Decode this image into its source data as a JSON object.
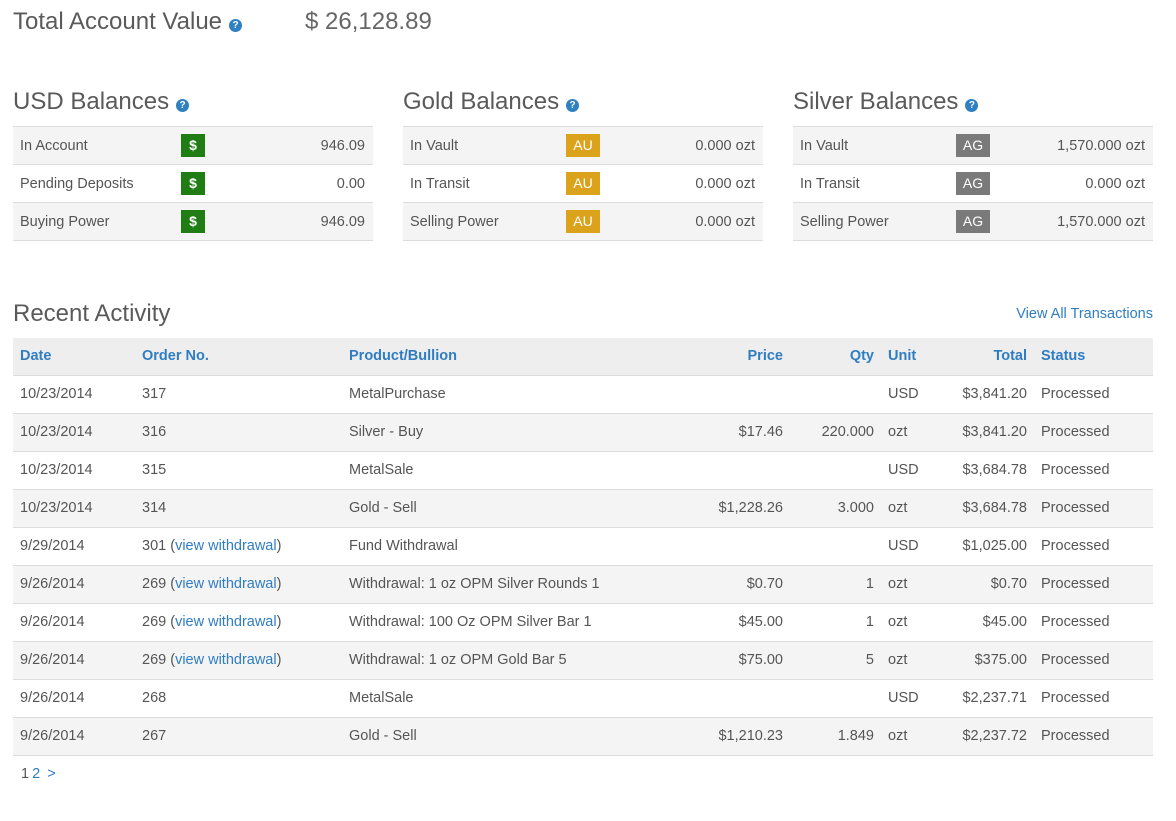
{
  "header": {
    "title": "Total Account Value",
    "value": "$ 26,128.89",
    "help_icon": "?"
  },
  "usd": {
    "title": "USD Balances",
    "rows": [
      {
        "label": "In Account",
        "badge": "$",
        "value": "946.09"
      },
      {
        "label": "Pending Deposits",
        "badge": "$",
        "value": "0.00"
      },
      {
        "label": "Buying Power",
        "badge": "$",
        "value": "946.09"
      }
    ]
  },
  "gold": {
    "title": "Gold Balances",
    "rows": [
      {
        "label": "In Vault",
        "badge": "AU",
        "value": "0.000 ozt"
      },
      {
        "label": "In Transit",
        "badge": "AU",
        "value": "0.000 ozt"
      },
      {
        "label": "Selling Power",
        "badge": "AU",
        "value": "0.000 ozt"
      }
    ]
  },
  "silver": {
    "title": "Silver Balances",
    "rows": [
      {
        "label": "In Vault",
        "badge": "AG",
        "value": "1,570.000 ozt"
      },
      {
        "label": "In Transit",
        "badge": "AG",
        "value": "0.000 ozt"
      },
      {
        "label": "Selling Power",
        "badge": "AG",
        "value": "1,570.000 ozt"
      }
    ]
  },
  "activity": {
    "title": "Recent Activity",
    "view_all": "View All Transactions",
    "columns": [
      "Date",
      "Order No.",
      "Product/Bullion",
      "Price",
      "Qty",
      "Unit",
      "Total",
      "Status"
    ],
    "rows": [
      {
        "date": "10/23/2014",
        "order": "317",
        "link": "",
        "product": "MetalPurchase",
        "price": "",
        "qty": "",
        "unit": "USD",
        "total": "$3,841.20",
        "status": "Processed"
      },
      {
        "date": "10/23/2014",
        "order": "316",
        "link": "",
        "product": "Silver - Buy",
        "price": "$17.46",
        "qty": "220.000",
        "unit": "ozt",
        "total": "$3,841.20",
        "status": "Processed"
      },
      {
        "date": "10/23/2014",
        "order": "315",
        "link": "",
        "product": "MetalSale",
        "price": "",
        "qty": "",
        "unit": "USD",
        "total": "$3,684.78",
        "status": "Processed"
      },
      {
        "date": "10/23/2014",
        "order": "314",
        "link": "",
        "product": "Gold - Sell",
        "price": "$1,228.26",
        "qty": "3.000",
        "unit": "ozt",
        "total": "$3,684.78",
        "status": "Processed"
      },
      {
        "date": "9/29/2014",
        "order": "301",
        "link": "view withdrawal",
        "product": "Fund Withdrawal",
        "price": "",
        "qty": "",
        "unit": "USD",
        "total": "$1,025.00",
        "status": "Processed"
      },
      {
        "date": "9/26/2014",
        "order": "269",
        "link": "view withdrawal",
        "product": "Withdrawal: 1 oz OPM Silver Rounds 1",
        "price": "$0.70",
        "qty": "1",
        "unit": "ozt",
        "total": "$0.70",
        "status": "Processed"
      },
      {
        "date": "9/26/2014",
        "order": "269",
        "link": "view withdrawal",
        "product": "Withdrawal: 100 Oz OPM Silver Bar 1",
        "price": "$45.00",
        "qty": "1",
        "unit": "ozt",
        "total": "$45.00",
        "status": "Processed"
      },
      {
        "date": "9/26/2014",
        "order": "269",
        "link": "view withdrawal",
        "product": "Withdrawal: 1 oz OPM Gold Bar 5",
        "price": "$75.00",
        "qty": "5",
        "unit": "ozt",
        "total": "$375.00",
        "status": "Processed"
      },
      {
        "date": "9/26/2014",
        "order": "268",
        "link": "",
        "product": "MetalSale",
        "price": "",
        "qty": "",
        "unit": "USD",
        "total": "$2,237.71",
        "status": "Processed"
      },
      {
        "date": "9/26/2014",
        "order": "267",
        "link": "",
        "product": "Gold - Sell",
        "price": "$1,210.23",
        "qty": "1.849",
        "unit": "ozt",
        "total": "$2,237.72",
        "status": "Processed"
      }
    ]
  },
  "pagination": {
    "current": "1",
    "next_page": "2",
    "next_arrow": ">"
  }
}
